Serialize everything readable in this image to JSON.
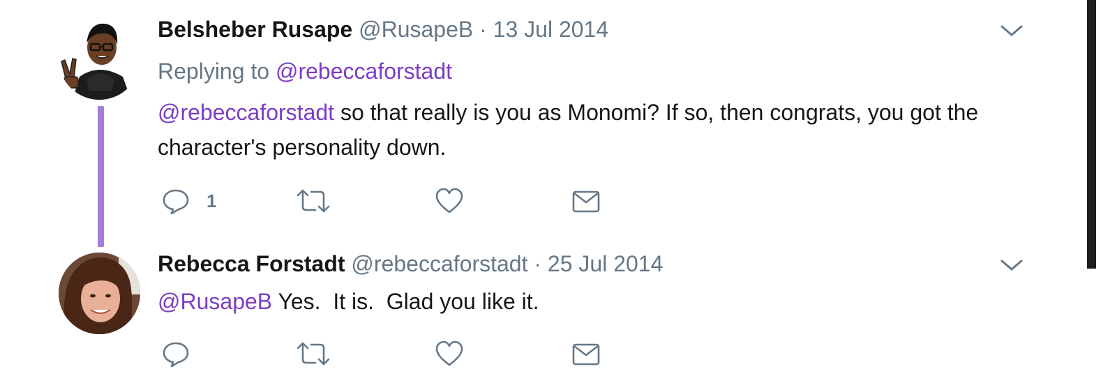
{
  "tweets": [
    {
      "display_name": "Belsheber Rusape",
      "handle": "@RusapeB",
      "separator": " · ",
      "date": "13 Jul 2014",
      "replying_prefix": "Replying to ",
      "replying_to": "@rebeccaforstadt",
      "mention": "@rebeccaforstadt",
      "text": " so that really is you as Monomi? If so, then congrats, you got the character's personality down.",
      "reply_count": "1",
      "avatar_icon": "cartoon-avatar"
    },
    {
      "display_name": "Rebecca Forstadt",
      "handle": "@rebeccaforstadt",
      "separator": " · ",
      "date": "25 Jul 2014",
      "mention": "@RusapeB",
      "text": " Yes.  It is.  Glad you like it.",
      "reply_count": "",
      "avatar_icon": "photo-avatar"
    }
  ],
  "colors": {
    "mention": "#7b3dc2",
    "thread_line": "#a57ddb",
    "muted": "#657786",
    "text": "#14171a"
  }
}
